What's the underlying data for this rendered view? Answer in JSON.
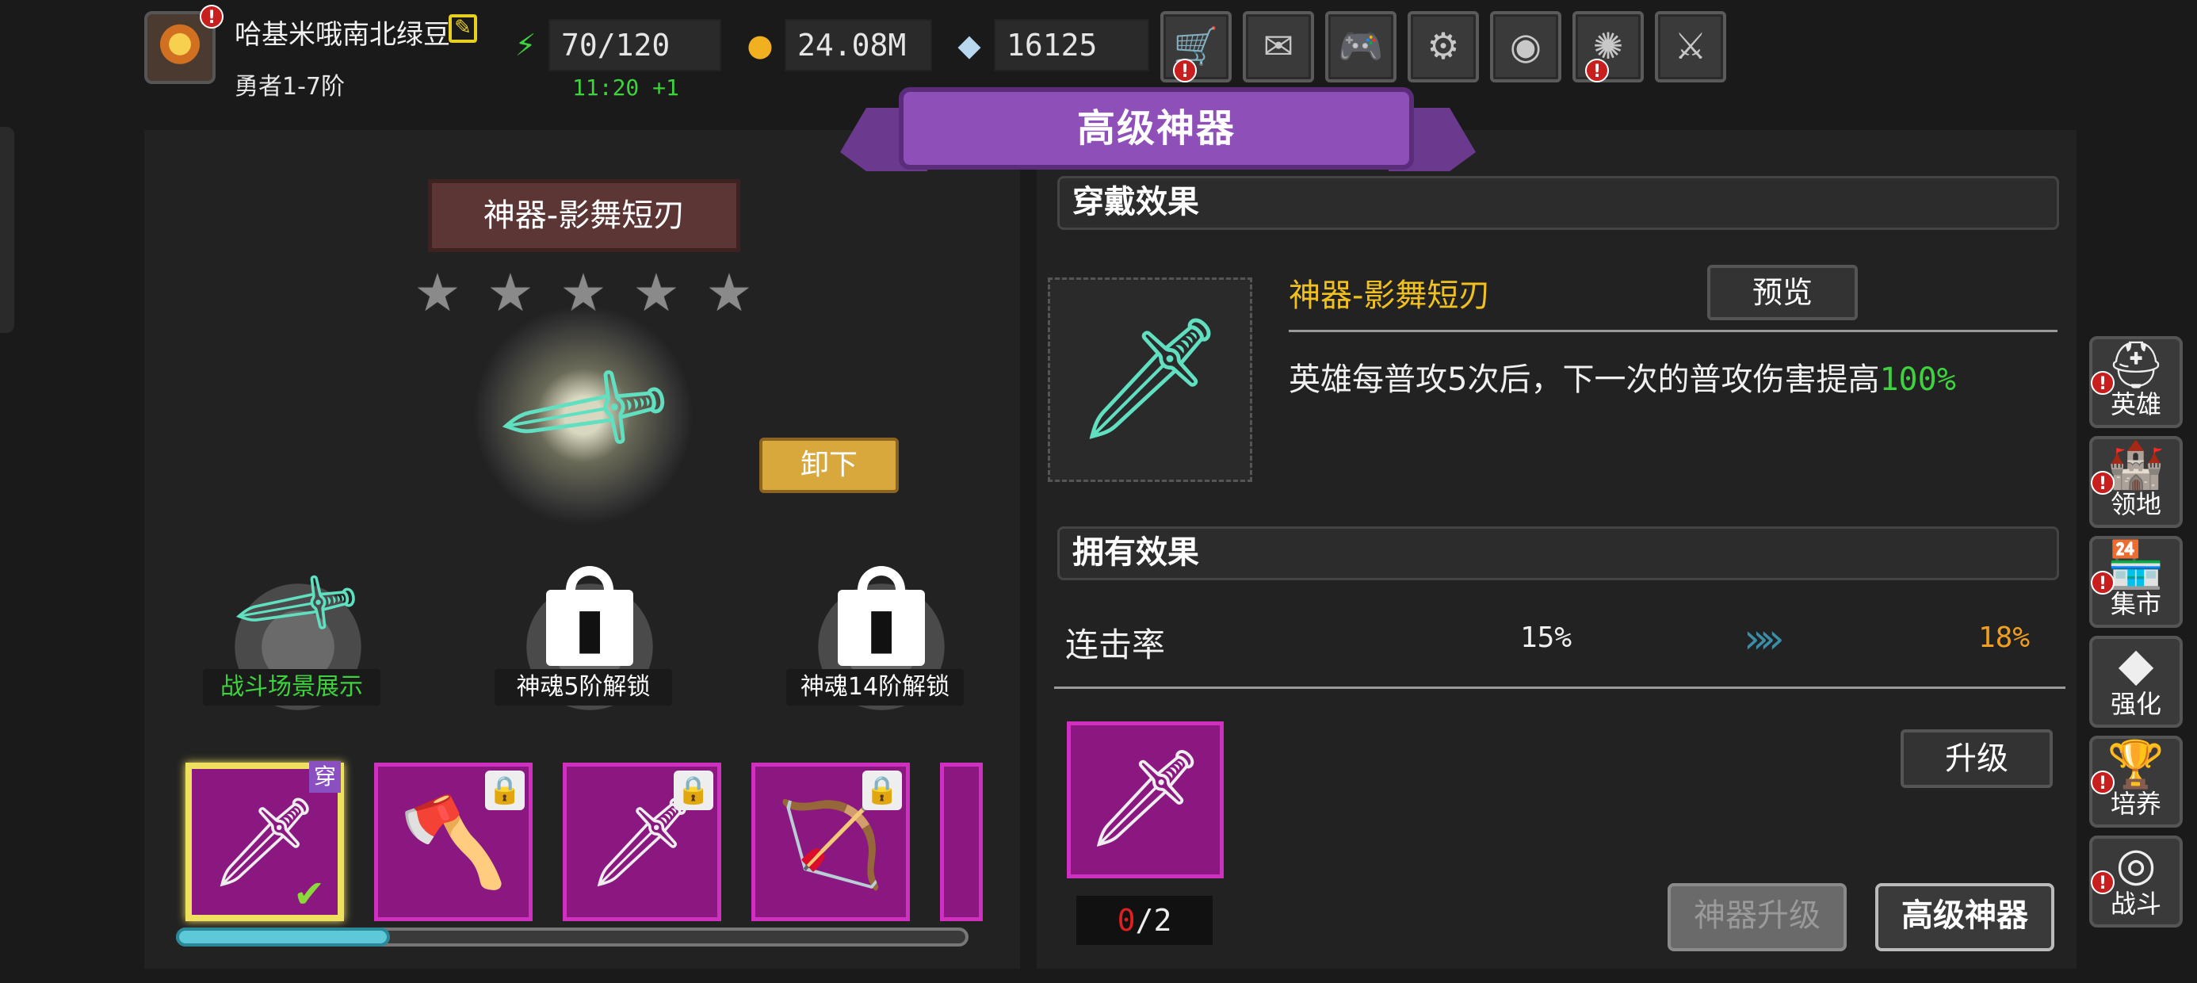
{
  "player": {
    "name": "哈基米哦南北绿豆",
    "rank": "勇者1-7阶",
    "alert": "!"
  },
  "resources": {
    "stamina": "70/120",
    "stamina_timer": "11:20 +1",
    "gold": "24.08M",
    "gems": "16125"
  },
  "toolbar": [
    {
      "name": "shop",
      "icon": "cart-icon",
      "glyph": "🛒",
      "alert": true
    },
    {
      "name": "mail",
      "icon": "mail-icon",
      "glyph": "✉",
      "alert": false
    },
    {
      "name": "gamepad",
      "icon": "gamepad-icon",
      "glyph": "🎮",
      "alert": false
    },
    {
      "name": "settings",
      "icon": "gear-icon",
      "glyph": "⚙",
      "alert": false
    },
    {
      "name": "lottery",
      "icon": "color-wheel-icon",
      "glyph": "◉",
      "alert": false
    },
    {
      "name": "fireworks",
      "icon": "fireworks-icon",
      "glyph": "✺",
      "alert": true
    },
    {
      "name": "battle",
      "icon": "crossed-swords-icon",
      "glyph": "⚔",
      "alert": false
    }
  ],
  "banner": {
    "title": "高级神器"
  },
  "artifact": {
    "title": "神器-影舞短刃",
    "stars": 5,
    "unequip_label": "卸下"
  },
  "slots": [
    {
      "label": "战斗场景展示",
      "locked": false,
      "color": "#3ed23e"
    },
    {
      "label": "神魂5阶解锁",
      "locked": true,
      "color": "#ffffff"
    },
    {
      "label": "神魂14阶解锁",
      "locked": true,
      "color": "#ffffff"
    }
  ],
  "inventory": {
    "equipped_badge": "穿",
    "check": "✔",
    "items": [
      {
        "glyph": "🗡",
        "locked": false,
        "selected": true
      },
      {
        "glyph": "🪓",
        "locked": true,
        "selected": false
      },
      {
        "glyph": "🗡",
        "locked": true,
        "selected": false
      },
      {
        "glyph": "🏹",
        "locked": true,
        "selected": false
      }
    ],
    "scroll_fraction": 0.27
  },
  "wear_effect": {
    "header": "穿戴效果",
    "item_name": "神器-影舞短刃",
    "preview_label": "预览",
    "desc_main": "英雄每普攻5次后，下一次的普攻伤害提高",
    "desc_value": "100%"
  },
  "own_effect": {
    "header": "拥有效果",
    "stat_name": "连击率",
    "current": "15%",
    "next": "18%"
  },
  "upgrade": {
    "material_owned": "0",
    "material_sep": "/",
    "material_needed": "2",
    "upgrade_label": "升级"
  },
  "tabs": {
    "upgrade_tab": "神器升级",
    "advanced_tab": "高级神器"
  },
  "sidebar": [
    {
      "label": "英雄",
      "icon": "helmet-icon",
      "glyph": "⛑",
      "alert": true
    },
    {
      "label": "领地",
      "icon": "castle-icon",
      "glyph": "🏰",
      "alert": true
    },
    {
      "label": "集市",
      "icon": "market-icon",
      "glyph": "🏪",
      "alert": true
    },
    {
      "label": "强化",
      "icon": "crystal-icon",
      "glyph": "◆",
      "alert": false
    },
    {
      "label": "培养",
      "icon": "trophy-icon",
      "glyph": "🏆",
      "alert": true
    },
    {
      "label": "战斗",
      "icon": "portal-icon",
      "glyph": "◎",
      "alert": true
    }
  ]
}
